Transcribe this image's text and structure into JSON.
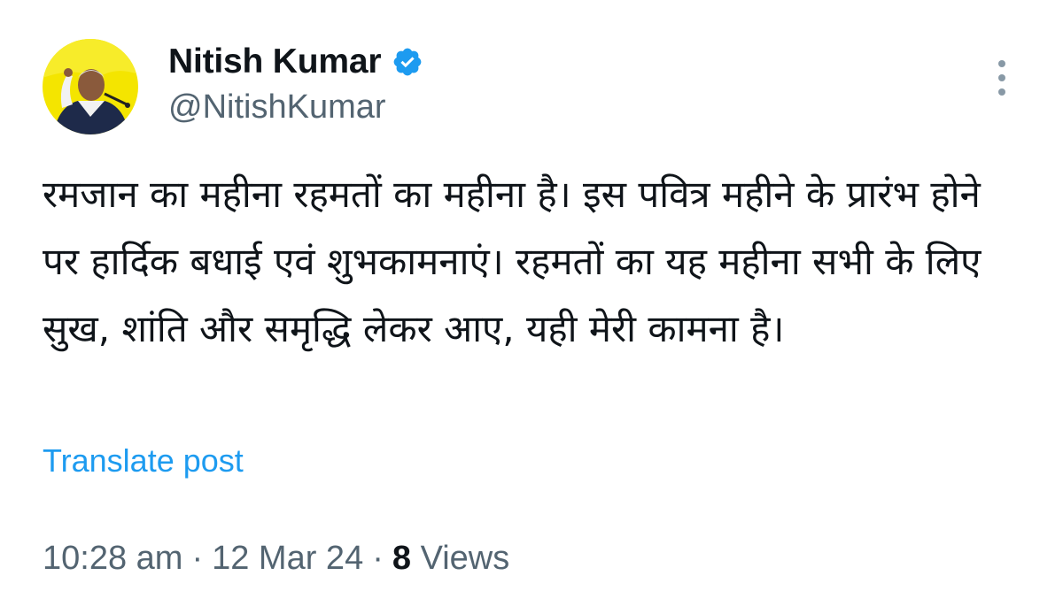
{
  "author": {
    "display_name": "Nitish Kumar",
    "handle": "@NitishKumar",
    "verified": true
  },
  "post": {
    "text": "रमजान का महीना रहमतों का महीना है। इस पवित्र महीने के प्रारंभ होने पर हार्दिक बधाई एवं शुभकामनाएं। रहमतों का यह महीना सभी के लिए सुख, शांति और समृद्धि लेकर आए, यही मेरी कामना है।"
  },
  "translate_label": "Translate post",
  "meta": {
    "time": "10:28 am",
    "separator": "·",
    "date": "12 Mar 24",
    "views_count": "8",
    "views_label": "Views"
  },
  "colors": {
    "accent": "#1d9bf0",
    "secondary_text": "#536471",
    "primary_text": "#0f1419",
    "avatar_background": "#f4e500"
  },
  "icons": {
    "verified": "verified-badge-icon",
    "more": "more-vertical-icon"
  }
}
